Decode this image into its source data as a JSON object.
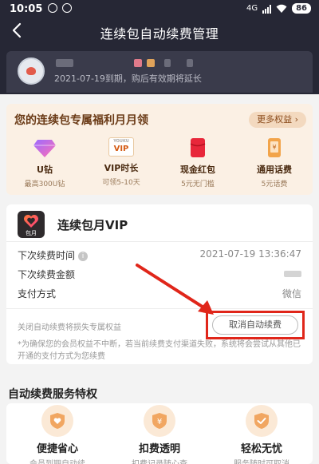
{
  "status_bar": {
    "time": "10:05",
    "network": "4G",
    "battery": "86"
  },
  "nav": {
    "title": "连续包自动续费管理"
  },
  "member": {
    "expiry_text": "2021-07-19到期，购后有效期将延长"
  },
  "benefits": {
    "heading": "您的连续包专属福利月月领",
    "more_label": "更多权益",
    "items": [
      {
        "name": "U钻",
        "desc": "最高300U钻",
        "icon": "diamond-icon"
      },
      {
        "name": "VIP时长",
        "desc": "可领5-10天",
        "icon": "vip-card-icon",
        "badge_top": "YOUKU",
        "badge": "VIP"
      },
      {
        "name": "现金红包",
        "desc": "5元无门槛",
        "icon": "red-envelope-icon",
        "badge": "淘"
      },
      {
        "name": "通用话费",
        "desc": "5元话费",
        "icon": "phone-credit-icon"
      }
    ]
  },
  "subscription": {
    "logo_tag": "包月",
    "title": "连续包月VIP",
    "next_time_label": "下次续费时间",
    "next_time_value": "2021-07-19 13:36:47",
    "next_amount_label": "下次续费金额",
    "payment_label": "支付方式",
    "payment_value": "微信",
    "warning": "关闭自动续费将损失专属权益",
    "cancel_label": "取消自动续费",
    "note": "*为确保您的会员权益不中断，若当前续费支付渠道失败，系统将会尝试从其他已开通的支付方式为您续费"
  },
  "features": {
    "title": "自动续费服务特权",
    "items": [
      {
        "name": "便捷省心",
        "desc": "会员到期自动续",
        "icon": "heart-shield-icon"
      },
      {
        "name": "扣费透明",
        "desc": "扣费记录随心查",
        "icon": "yen-shield-icon"
      },
      {
        "name": "轻松无忧",
        "desc": "服务随时可取消",
        "icon": "check-shield-icon"
      }
    ]
  },
  "colors": {
    "header_bg": "#262735",
    "accent_brown": "#6a3a16",
    "highlight_red": "#e0261a"
  }
}
